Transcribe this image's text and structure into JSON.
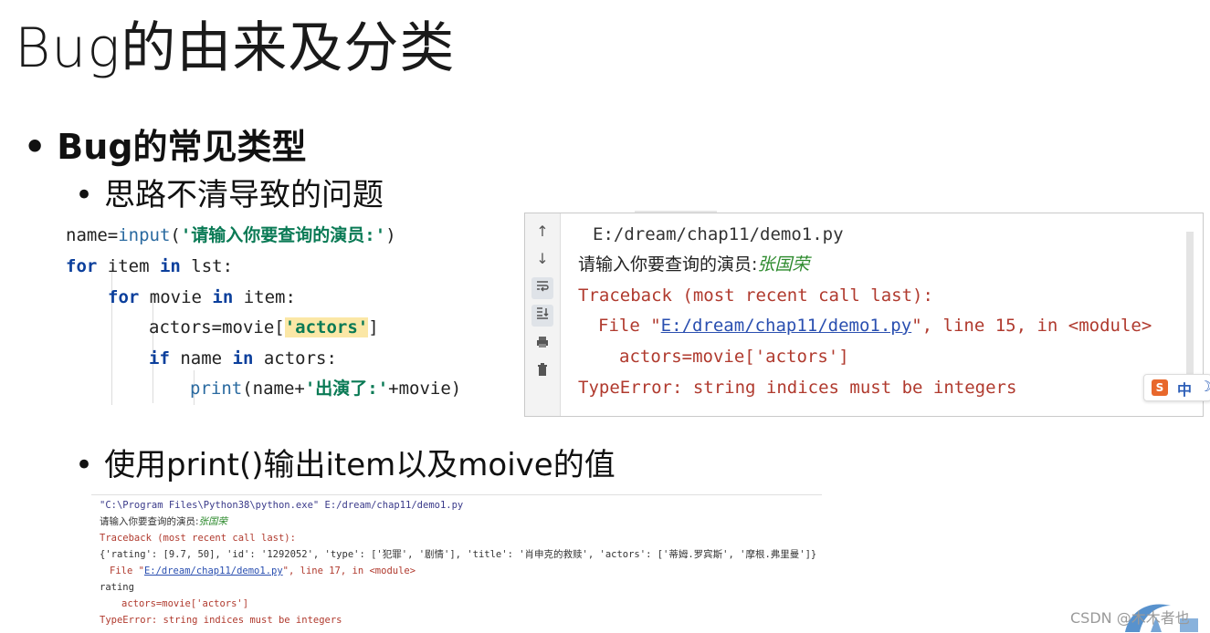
{
  "slide": {
    "title": "Bug的由来及分类",
    "bullet_main": "Bug的常见类型",
    "bullet_sub1": "思路不清导致的问题",
    "bullet_sub2": "使用print()输出item以及moive的值"
  },
  "code": {
    "line1": {
      "a": "name=",
      "fn": "input",
      "b": "(",
      "str": "'请输入你要查询的演员:'",
      "c": ")"
    },
    "line2": {
      "kw1": "for",
      "a": " item ",
      "kw2": "in",
      "b": " lst:"
    },
    "line3": {
      "kw1": "for",
      "a": " movie ",
      "kw2": "in",
      "b": " item:"
    },
    "line4": {
      "a": "actors=movie[",
      "str": "'actors'",
      "b": "]"
    },
    "line5": {
      "kw1": "if",
      "a": " name ",
      "kw2": "in",
      "b": " actors:"
    },
    "line6": {
      "fn": "print",
      "a": "(name+",
      "str": "'出演了:'",
      "b": "+movie)"
    }
  },
  "console": {
    "path": "E:/dream/chap11/demo1.py",
    "prompt": "请输入你要查询的演员:",
    "input_value": "张国荣",
    "traceback": "Traceback (most recent call last):",
    "file_prefix": "File \"",
    "file_link": "E:/dream/chap11/demo1.py",
    "file_suffix": "\", line 15, in <module>",
    "code_line": "actors=movie['actors']",
    "error": "TypeError: string indices must be integers",
    "toolbar_icons": [
      "arrow-up-icon",
      "arrow-down-icon",
      "soft-wrap-icon",
      "scroll-to-end-icon",
      "print-icon",
      "trash-icon"
    ]
  },
  "ime": {
    "mode": "中",
    "logo": "S"
  },
  "console2": {
    "command": "\"C:\\Program Files\\Python38\\python.exe\" E:/dream/chap11/demo1.py",
    "prompt": "请输入你要查询的演员:",
    "input_value": "张国荣",
    "traceback": "Traceback (most recent call last):",
    "dict_line": "{'rating': [9.7, 50], 'id': '1292052', 'type': ['犯罪', '剧情'], 'title': '肖申克的救赎', 'actors': ['蒂姆.罗宾斯', '摩根.弗里曼']}",
    "file_prefix": "File \"",
    "file_link": "E:/dream/chap11/demo1.py",
    "file_suffix": "\", line 17, in <module>",
    "rating": "rating",
    "code_line": "actors=movie['actors']",
    "error": "TypeError: string indices must be integers"
  },
  "watermark": "CSDN @木木者也",
  "colors": {
    "keyword": "#0b3f9c",
    "string": "#0a7a55",
    "error": "#b03a2e",
    "link": "#2a4fb0",
    "user_input": "#2e8b2e"
  }
}
